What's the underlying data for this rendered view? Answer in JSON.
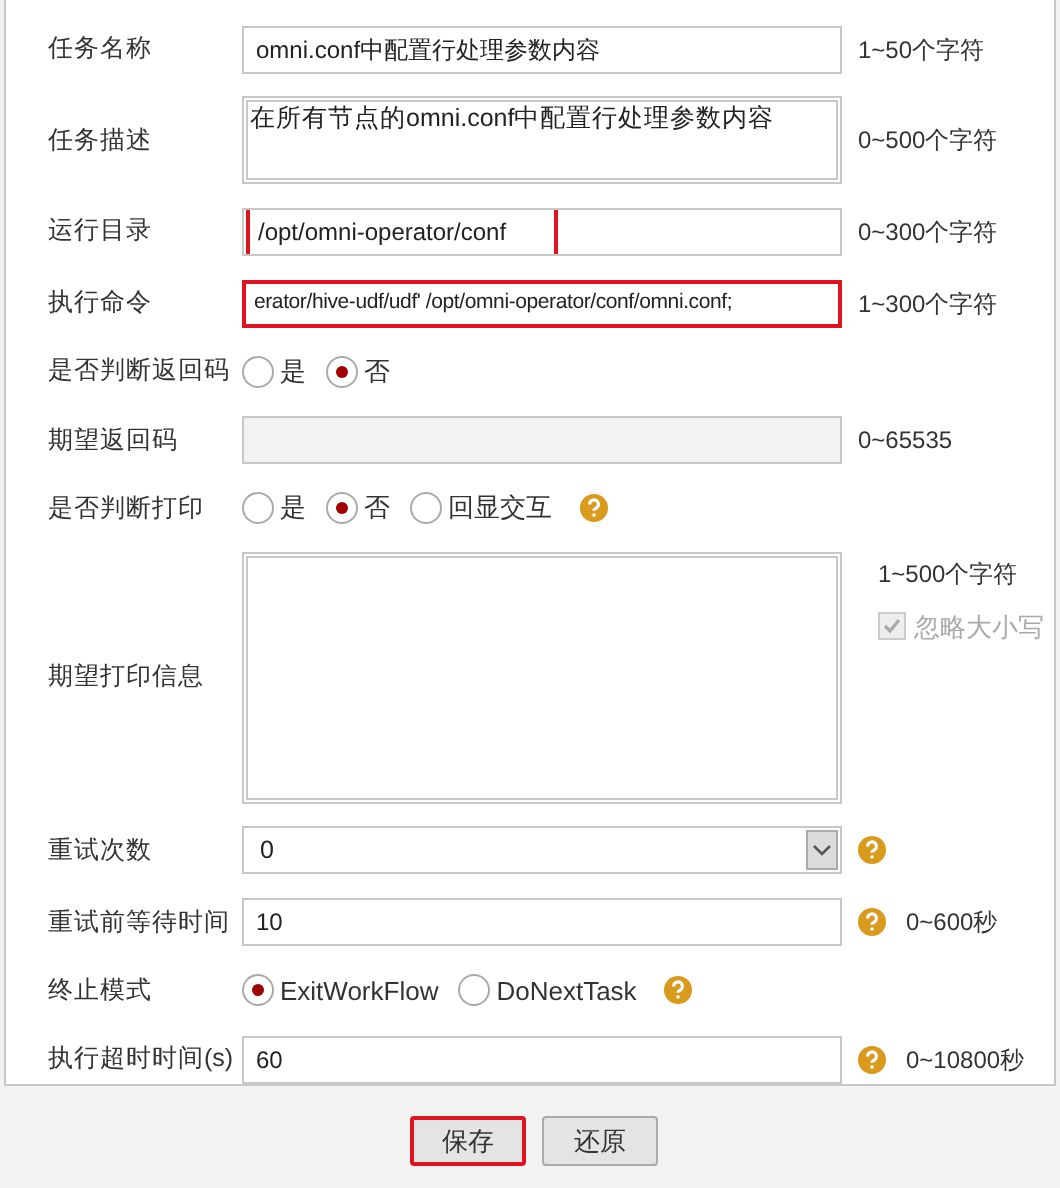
{
  "fields": [
    {
      "kind": "text",
      "label": "任务名称",
      "value": "omni.conf中配置行处理参数内容",
      "hint": "1~50个字符",
      "disabled": false
    },
    {
      "kind": "textarea",
      "label": "任务描述",
      "value": "在所有节点的omni.conf中配置行处理参数内容",
      "hint": "0~500个字符"
    },
    {
      "kind": "text",
      "label": "运行目录",
      "value": "/opt/omni-operator/conf",
      "hint": "0~300个字符",
      "value_outlined": true,
      "disabled": false
    },
    {
      "kind": "text",
      "label": "执行命令",
      "value": "erator/hive-udf/udf' /opt/omni-operator/conf/omni.conf;",
      "hint": "1~300个字符",
      "field_outlined": true,
      "disabled": false
    },
    {
      "kind": "radio",
      "label": "是否判断返回码",
      "options": [
        {
          "label": "是",
          "selected": false
        },
        {
          "label": "否",
          "selected": true
        }
      ]
    },
    {
      "kind": "text",
      "label": "期望返回码",
      "hint": "0~65535",
      "disabled": true
    },
    {
      "kind": "radio",
      "label": "是否判断打印",
      "options": [
        {
          "label": "是",
          "selected": false
        },
        {
          "label": "否",
          "selected": true
        },
        {
          "label": "回显交互",
          "selected": false
        }
      ],
      "help": true
    },
    {
      "kind": "bigtext",
      "label": "期望打印信息",
      "hint": "1~500个字符",
      "checkbox": {
        "label": "忽略大小写",
        "checked": true,
        "disabled": true
      }
    },
    {
      "kind": "select",
      "label": "重试次数",
      "value": "0",
      "help": true
    },
    {
      "kind": "text",
      "label": "重试前等待时间",
      "value": "10",
      "hint": "0~600秒",
      "disabled": false,
      "help": true
    },
    {
      "kind": "radio",
      "label": "终止模式",
      "options": [
        {
          "label": "ExitWorkFlow",
          "selected": true
        },
        {
          "label": "DoNextTask",
          "selected": false
        }
      ],
      "help": true
    },
    {
      "kind": "text",
      "label": "执行超时时间(s)",
      "value": "60",
      "hint": "0~10800秒",
      "disabled": false,
      "help": true
    }
  ],
  "buttons": [
    {
      "label": "保存",
      "highlight": true
    },
    {
      "label": "还原",
      "highlight": false
    }
  ]
}
